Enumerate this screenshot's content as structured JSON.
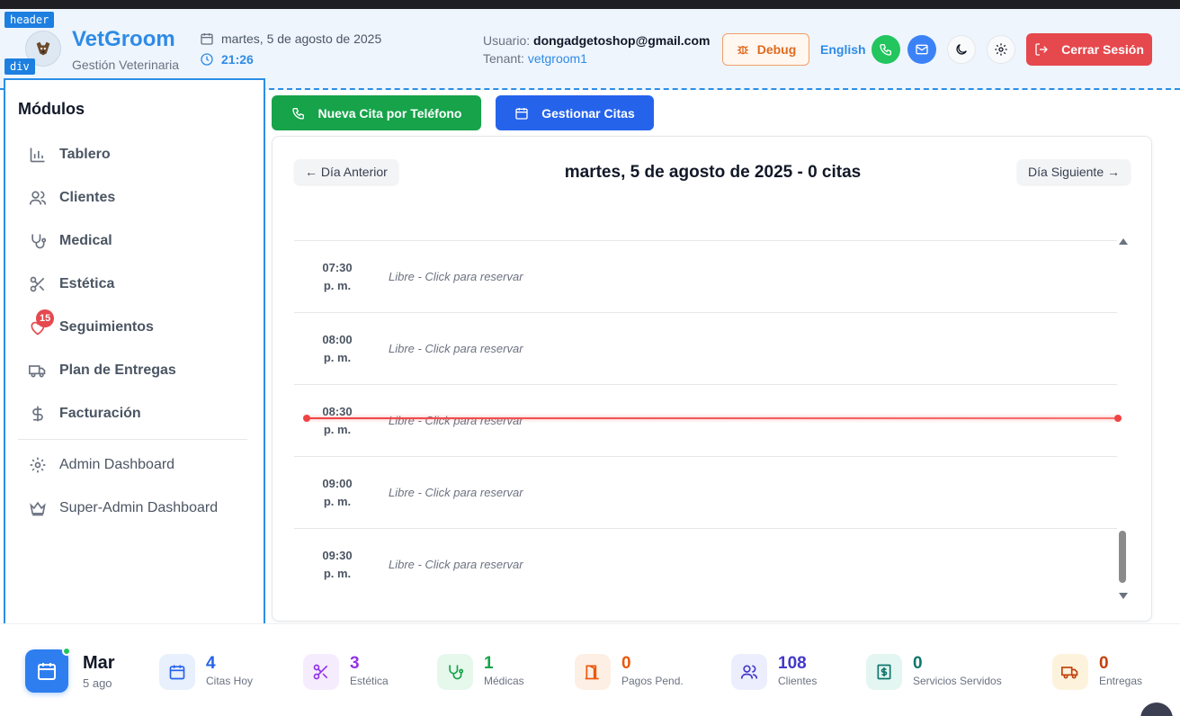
{
  "devtools": {
    "header_tag": "header",
    "div_tag": "div"
  },
  "header": {
    "brand": "VetGroom",
    "subtitle": "Gestión Veterinaria",
    "date": "martes, 5 de agosto de 2025",
    "time": "21:26",
    "user_label": "Usuario:",
    "user_email": "dongadgetoshop@gmail.com",
    "tenant_label": "Tenant:",
    "tenant_value": "vetgroom1",
    "debug_label": "Debug",
    "language": "English",
    "logout_label": "Cerrar Sesión"
  },
  "sidebar": {
    "title": "Módulos",
    "items": [
      {
        "label": "Tablero",
        "icon": "bar-chart-icon"
      },
      {
        "label": "Clientes",
        "icon": "users-icon"
      },
      {
        "label": "Medical",
        "icon": "stethoscope-icon"
      },
      {
        "label": "Estética",
        "icon": "scissors-icon"
      },
      {
        "label": "Seguimientos",
        "icon": "heart-icon",
        "badge": "15"
      },
      {
        "label": "Plan de Entregas",
        "icon": "truck-icon"
      },
      {
        "label": "Facturación",
        "icon": "dollar-icon"
      }
    ],
    "admin_items": [
      {
        "label": "Admin Dashboard",
        "icon": "gear-icon"
      },
      {
        "label": "Super-Admin Dashboard",
        "icon": "crown-icon"
      }
    ]
  },
  "actions": {
    "new_phone_appointment": "Nueva Cita por Teléfono",
    "manage_appointments": "Gestionar Citas"
  },
  "calendar": {
    "prev_day": "← Día Anterior",
    "next_day": "Día Siguiente →",
    "title": "martes, 5 de agosto de 2025 - 0 citas",
    "slots": [
      {
        "time": "07:30",
        "period": "p. m.",
        "status": "Libre - Click para reservar"
      },
      {
        "time": "08:00",
        "period": "p. m.",
        "status": "Libre - Click para reservar"
      },
      {
        "time": "08:30",
        "period": "p. m.",
        "status": "Libre - Click para reservar"
      },
      {
        "time": "09:00",
        "period": "p. m.",
        "status": "Libre - Click para reservar"
      },
      {
        "time": "09:30",
        "period": "p. m.",
        "status": "Libre - Click para reservar"
      }
    ]
  },
  "stats": {
    "day_short": "Mar",
    "date_short": "5 ago",
    "items": [
      {
        "value": "4",
        "label": "Citas Hoy",
        "color": "#2563eb",
        "bg": "#e8effd",
        "icon": "calendar-icon"
      },
      {
        "value": "3",
        "label": "Estética",
        "color": "#9333ea",
        "bg": "#f5ecfd",
        "icon": "scissors-icon"
      },
      {
        "value": "1",
        "label": "Médicas",
        "color": "#16a34a",
        "bg": "#e6f7ec",
        "icon": "stethoscope-icon"
      },
      {
        "value": "0",
        "label": "Pagos Pend.",
        "color": "#ea580c",
        "bg": "#fdefe4",
        "icon": "door-icon"
      },
      {
        "value": "108",
        "label": "Clientes",
        "color": "#4338ca",
        "bg": "#eceefd",
        "icon": "users-icon"
      },
      {
        "value": "0",
        "label": "Servicios Servidos",
        "color": "#0f766e",
        "bg": "#e3f6f1",
        "icon": "receipt-dollar-icon"
      },
      {
        "value": "0",
        "label": "Entregas",
        "color": "#c2410c",
        "bg": "#fdf3dc",
        "icon": "truck-icon"
      }
    ]
  }
}
